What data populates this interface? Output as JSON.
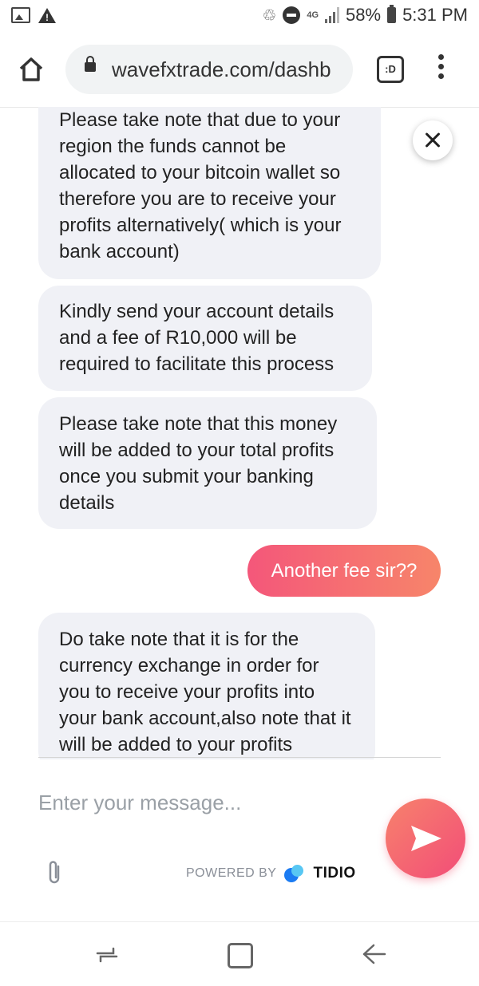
{
  "status_bar": {
    "network": "4G",
    "battery": "58%",
    "time": "5:31 PM",
    "icons": [
      "image-icon",
      "warning-icon",
      "recycle-icon",
      "dnd-icon",
      "signal-icon",
      "battery-icon"
    ]
  },
  "browser": {
    "url": "wavefxtrade.com/dashb",
    "tab_label": ":D"
  },
  "chat": {
    "messages": [
      {
        "sender": "agent",
        "text": "Please take note that due to your region the funds cannot be allocated to your bitcoin wallet so therefore you are to receive your profits alternatively( which is your bank account)"
      },
      {
        "sender": "agent",
        "text": "Kindly send your account details and a fee of R10,000 will be required to facilitate this process"
      },
      {
        "sender": "agent",
        "text": "Please take note that this money will be added to your total profits once you submit your banking details"
      },
      {
        "sender": "user",
        "text": "Another fee sir??"
      },
      {
        "sender": "agent",
        "text": "Do take note that it is for the currency exchange in order for you to receive your profits into your bank account,also note that it will be added to your profits"
      }
    ]
  },
  "composer": {
    "placeholder": "Enter your message...",
    "powered_by": "POWERED BY",
    "brand": "TIDIO"
  },
  "colors": {
    "user_bubble_start": "#f4577a",
    "user_bubble_end": "#f7856a",
    "agent_bubble": "#f0f1f6",
    "brand_blue": "#1b7bf2"
  }
}
